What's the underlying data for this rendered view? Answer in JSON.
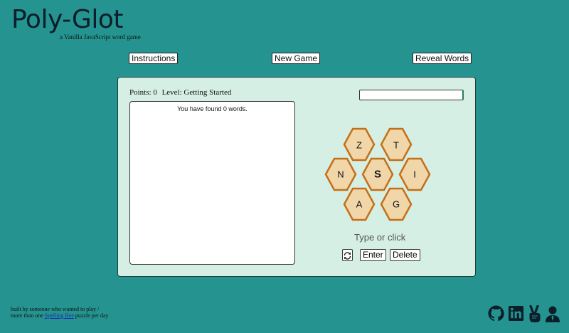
{
  "header": {
    "title": "Poly-Glot",
    "subtitle": "a Vanilla JavaScript word game"
  },
  "nav": {
    "instructions": "Instructions",
    "new_game": "New Game",
    "reveal_words": "Reveal Words"
  },
  "game": {
    "points_label": "Points: 0",
    "level_label": "Level: Getting Started",
    "input_value": "",
    "found_words_text": "You have found 0 words.",
    "letters": {
      "center": "S",
      "outer": [
        "Z",
        "T",
        "N",
        "I",
        "A",
        "G"
      ]
    },
    "prompt": "Type or click",
    "enter": "Enter",
    "delete": "Delete",
    "shuffle_icon": "shuffle-icon"
  },
  "footer": {
    "line1": "built by someone who wanted to play /",
    "line2_prefix": "more than one ",
    "link": "Spelling Bee",
    "line2_suffix": " puzzle per day"
  },
  "social": [
    "github-icon",
    "linkedin-icon",
    "peace-hand-icon",
    "person-icon"
  ],
  "colors": {
    "background": "#25938f",
    "panel": "#d6efe4",
    "hex_fill": "#f0d6a8",
    "hex_stroke": "#c46f18"
  }
}
